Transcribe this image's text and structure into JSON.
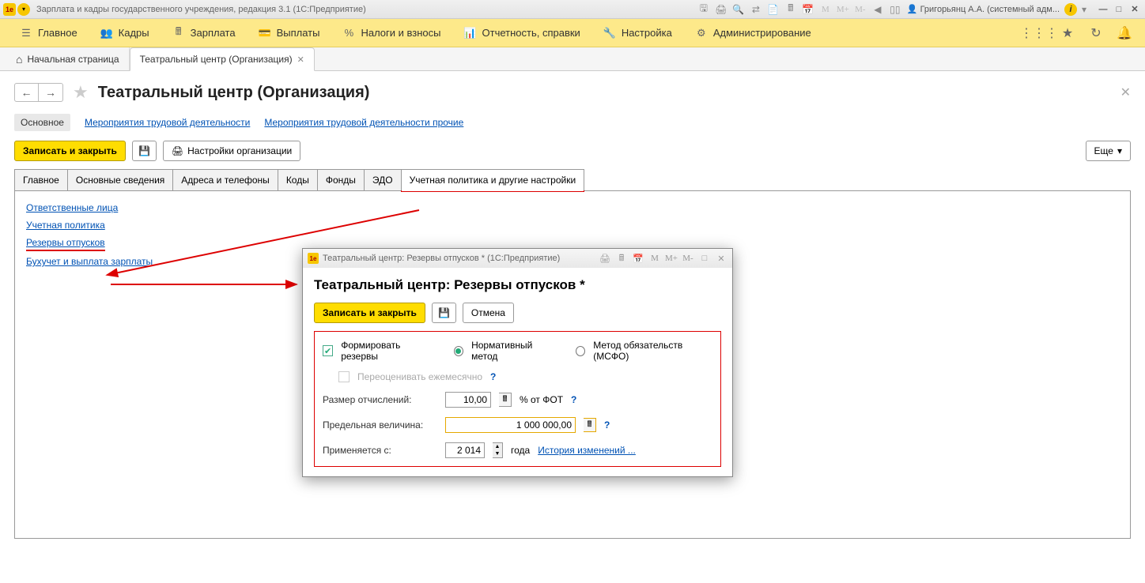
{
  "titlebar": {
    "app_title": "Зарплата и кадры государственного учреждения, редакция 3.1  (1С:Предприятие)",
    "user": "Григорьянц А.А. (системный адм..."
  },
  "menubar": {
    "items": [
      {
        "label": "Главное"
      },
      {
        "label": "Кадры"
      },
      {
        "label": "Зарплата"
      },
      {
        "label": "Выплаты"
      },
      {
        "label": "Налоги и взносы"
      },
      {
        "label": "Отчетность, справки"
      },
      {
        "label": "Настройка"
      },
      {
        "label": "Администрирование"
      }
    ]
  },
  "tabs": {
    "home": "Начальная страница",
    "org": "Театральный центр (Организация)"
  },
  "page": {
    "title": "Театральный центр (Организация)",
    "sub": {
      "main": "Основное",
      "link1": "Мероприятия трудовой деятельности",
      "link2": "Мероприятия трудовой деятельности прочие"
    },
    "toolbar": {
      "save": "Записать и закрыть",
      "settings": "Настройки организации",
      "more": "Еще"
    },
    "inner_tabs": [
      "Главное",
      "Основные сведения",
      "Адреса и телефоны",
      "Коды",
      "Фонды",
      "ЭДО",
      "Учетная политика и другие настройки"
    ],
    "links": [
      "Ответственные лица",
      "Учетная политика",
      "Резервы отпусков",
      "Бухучет и выплата зарплаты"
    ]
  },
  "modal": {
    "window_title": "Театральный центр: Резервы отпусков *  (1С:Предприятие)",
    "heading": "Театральный центр: Резервы отпусков *",
    "save": "Записать и закрыть",
    "cancel": "Отмена",
    "form": {
      "chk_form": "Формировать резервы",
      "radio_norm": "Нормативный метод",
      "radio_ifrs": "Метод обязательств (МСФО)",
      "chk_monthly": "Переоценивать ежемесячно",
      "lbl_rate": "Размер отчислений:",
      "rate_val": "10,00",
      "rate_suffix": "% от ФОТ",
      "lbl_limit": "Предельная величина:",
      "limit_val": "1 000 000,00",
      "lbl_year": "Применяется с:",
      "year_val": "2 014",
      "year_suffix": "года",
      "history": "История изменений ..."
    }
  }
}
